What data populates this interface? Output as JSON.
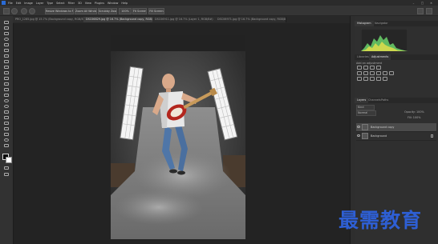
{
  "menubar": {
    "app_icon": "photoshop-app-icon",
    "items": [
      "File",
      "Edit",
      "Image",
      "Layer",
      "Type",
      "Select",
      "Filter",
      "3D",
      "View",
      "Plugins",
      "Window",
      "Help"
    ],
    "window_controls": [
      "–",
      "□",
      "✕"
    ]
  },
  "optionsbar": {
    "home_icon": "home-icon",
    "zoom_in_icon": "zoom-in-icon",
    "zoom_out_icon": "zoom-out-icon",
    "resize_windows_label": "Resize Windows to Fit",
    "zoom_all_label": "Zoom All Windows",
    "scrubby_zoom_label": "Scrubby Zoom",
    "zoom_percent": "100%",
    "fit_screen_label": "Fit Screen",
    "fill_screen_label": "Fill Screen"
  },
  "document_tabs": [
    {
      "label": "PRO_1285.jpg @ 15.7% (Background copy, RGB/8#)",
      "active": false
    },
    {
      "label": "DSC06829.jpg @ 16.7% (Background copy, RGB/8#)",
      "active": true
    },
    {
      "label": "DSC06911.jpg @ 16.7% (Layer 1, RGB/8#)",
      "active": false
    },
    {
      "label": "DSC06971.jpg @ 16.7% (Background copy, RGB/8#)",
      "active": false
    }
  ],
  "panels": {
    "top_tabs": [
      "Histogram",
      "Navigator"
    ],
    "adjust_tabs": [
      "Libraries",
      "Adjustments"
    ],
    "adjust_label": "Add an adjustment",
    "layers_tabs": [
      "Layers",
      "Channels",
      "Paths"
    ],
    "kind_label": "Kind",
    "blend_mode": "Normal",
    "opacity_label": "Opacity: 100%",
    "fill_label": "Fill: 100%",
    "layers": [
      {
        "name": "Background copy",
        "selected": true
      },
      {
        "name": "Background",
        "selected": false
      }
    ]
  },
  "watermark": "最需教育",
  "colors": {
    "accent": "#2e5fd4",
    "ps_blue": "#2a6bd6",
    "panel_bg": "#2f2f2f",
    "histogram_green": "#6bd36b",
    "histogram_yellow": "#e8e04a"
  }
}
